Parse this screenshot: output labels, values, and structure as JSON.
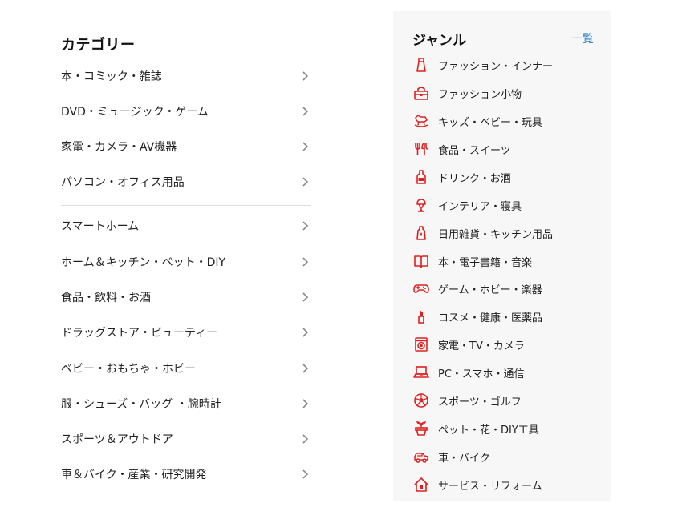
{
  "categories": {
    "title": "カテゴリー",
    "items": [
      {
        "label": "本・コミック・雑誌"
      },
      {
        "label": "DVD・ミュージック・ゲーム"
      },
      {
        "label": "家電・カメラ・AV機器"
      },
      {
        "label": "パソコン・オフィス用品"
      },
      {
        "label": "スマートホーム"
      },
      {
        "label": "ホーム＆キッチン・ペット・DIY"
      },
      {
        "label": "食品・飲料・お酒"
      },
      {
        "label": "ドラッグストア・ビューティー"
      },
      {
        "label": "ベビー・おもちゃ・ホビー"
      },
      {
        "label": "服・シューズ・バッグ ・腕時計"
      },
      {
        "label": "スポーツ＆アウトドア"
      },
      {
        "label": "車＆バイク・産業・研究開発"
      }
    ],
    "chevron_icon": "chevron-right-icon"
  },
  "genres": {
    "title": "ジャンル",
    "all_link": "一覧",
    "accent_color": "#e02020",
    "link_color": "#2a7fc1",
    "items": [
      {
        "label": "ファッション・インナー",
        "icon": "dress-icon"
      },
      {
        "label": "ファッション小物",
        "icon": "handbag-icon"
      },
      {
        "label": "キッズ・ベビー・玩具",
        "icon": "rocking-horse-icon"
      },
      {
        "label": "食品・スイーツ",
        "icon": "fork-knife-icon"
      },
      {
        "label": "ドリンク・お酒",
        "icon": "bottle-icon"
      },
      {
        "label": "インテリア・寝具",
        "icon": "lamp-icon"
      },
      {
        "label": "日用雑貨・キッチン用品",
        "icon": "detergent-icon"
      },
      {
        "label": "本・電子書籍・音楽",
        "icon": "book-icon"
      },
      {
        "label": "ゲーム・ホビー・楽器",
        "icon": "gamepad-icon"
      },
      {
        "label": "コスメ・健康・医薬品",
        "icon": "lipstick-icon"
      },
      {
        "label": "家電・TV・カメラ",
        "icon": "washing-machine-icon"
      },
      {
        "label": "PC・スマホ・通信",
        "icon": "laptop-icon"
      },
      {
        "label": "スポーツ・ゴルフ",
        "icon": "soccer-ball-icon"
      },
      {
        "label": "ペット・花・DIY工具",
        "icon": "flower-pot-icon"
      },
      {
        "label": "車・バイク",
        "icon": "car-icon"
      },
      {
        "label": "サービス・リフォーム",
        "icon": "house-icon"
      }
    ]
  }
}
